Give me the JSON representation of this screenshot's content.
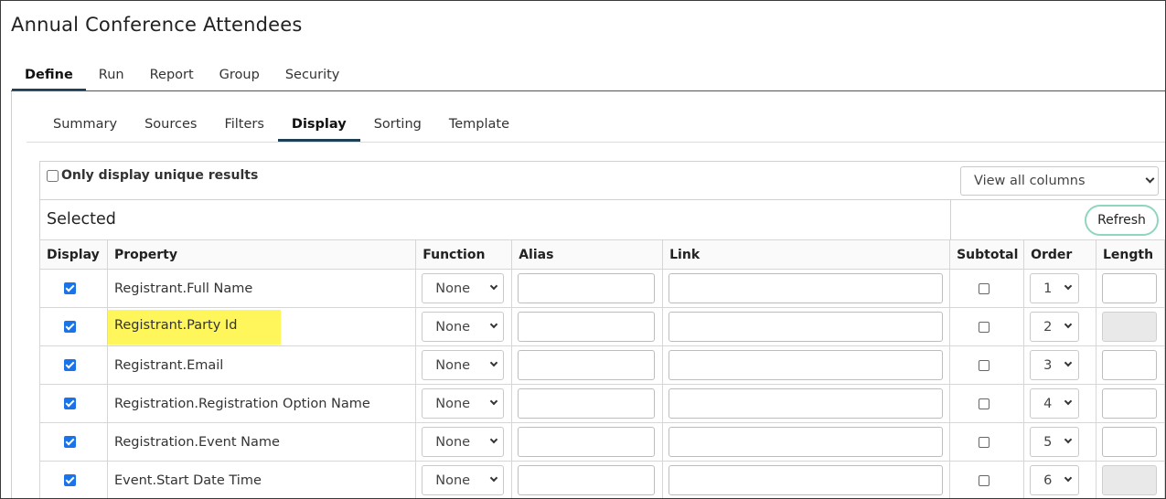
{
  "page": {
    "title": "Annual Conference Attendees"
  },
  "main_tabs": [
    {
      "label": "Define",
      "active": true
    },
    {
      "label": "Run",
      "active": false
    },
    {
      "label": "Report",
      "active": false
    },
    {
      "label": "Group",
      "active": false
    },
    {
      "label": "Security",
      "active": false
    }
  ],
  "sub_tabs": [
    {
      "label": "Summary",
      "active": false
    },
    {
      "label": "Sources",
      "active": false
    },
    {
      "label": "Filters",
      "active": false
    },
    {
      "label": "Display",
      "active": true
    },
    {
      "label": "Sorting",
      "active": false
    },
    {
      "label": "Template",
      "active": false
    }
  ],
  "options": {
    "unique_label": "Only display unique results",
    "unique_checked": false,
    "view_select": "View all columns"
  },
  "selected": {
    "heading": "Selected",
    "refresh_label": "Refresh"
  },
  "columns": [
    "Display",
    "Property",
    "Function",
    "Alias",
    "Link",
    "Subtotal",
    "Order",
    "Length"
  ],
  "rows": [
    {
      "display": true,
      "property": "Registrant.Full Name",
      "function": "None",
      "alias": "",
      "link": "",
      "subtotal": false,
      "order": "1",
      "length": "",
      "length_disabled": false,
      "highlighted": false
    },
    {
      "display": true,
      "property": "Registrant.Party Id",
      "function": "None",
      "alias": "",
      "link": "",
      "subtotal": false,
      "order": "2",
      "length": "",
      "length_disabled": true,
      "highlighted": true
    },
    {
      "display": true,
      "property": "Registrant.Email",
      "function": "None",
      "alias": "",
      "link": "",
      "subtotal": false,
      "order": "3",
      "length": "",
      "length_disabled": false,
      "highlighted": false
    },
    {
      "display": true,
      "property": "Registration.Registration Option Name",
      "function": "None",
      "alias": "",
      "link": "",
      "subtotal": false,
      "order": "4",
      "length": "",
      "length_disabled": false,
      "highlighted": false
    },
    {
      "display": true,
      "property": "Registration.Event Name",
      "function": "None",
      "alias": "",
      "link": "",
      "subtotal": false,
      "order": "5",
      "length": "",
      "length_disabled": false,
      "highlighted": false
    },
    {
      "display": true,
      "property": "Event.Start Date Time",
      "function": "None",
      "alias": "",
      "link": "",
      "subtotal": false,
      "order": "6",
      "length": "",
      "length_disabled": true,
      "highlighted": false
    }
  ],
  "colors": {
    "accent_underline": "#1f3f55",
    "checkbox_blue": "#1a73e8",
    "highlight_yellow": "#fef65a",
    "refresh_border": "#8fd6bf"
  }
}
